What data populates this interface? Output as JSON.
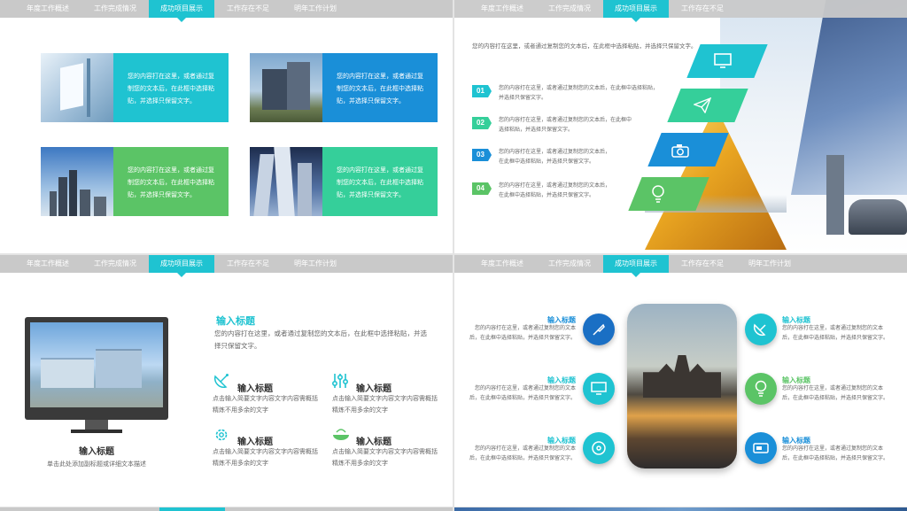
{
  "nav": [
    "年度工作概述",
    "工作完成情况",
    "成功项目展示",
    "工作存在不足",
    "明年工作计划"
  ],
  "placeholder_short": "您的内容打在这里，或者通过复制您的文本后，在此框中选择粘贴，并选择只保留文字。",
  "s2": {
    "intro": "您的内容打在这里，或者通过复制您的文本后，在此框中选择粘贴，并选择只保留文字。",
    "steps": [
      {
        "num": "01",
        "text": "您的内容打在这里，或者通过复制您的文本后，在此框中选择粘贴，并选择只保留文字。"
      },
      {
        "num": "02",
        "text": "您的内容打在这里，或者通过复制您的文本后，在此框中选择粘贴，并选择只保留文字。"
      },
      {
        "num": "03",
        "text": "您的内容打在这里，或者通过复制您的文本后，在此框中选择粘贴，并选择只保留文字。"
      },
      {
        "num": "04",
        "text": "您的内容打在这里，或者通过复制您的文本后，在此框中选择粘贴，并选择只保留文字。"
      }
    ]
  },
  "s3": {
    "title": "输入标题",
    "body": "您的内容打在这里，或者通过复制您的文本后，在此框中选择粘贴，并选择只保留文字。",
    "monitor_title": "输入标题",
    "monitor_caption": "单击此处添加副标题或详细文本描述",
    "items": [
      {
        "title": "输入标题",
        "text": "点击输入简要文字内容文字内容需概括精炼不用多余的文字"
      },
      {
        "title": "输入标题",
        "text": "点击输入简要文字内容文字内容需概括精炼不用多余的文字"
      },
      {
        "title": "输入标题",
        "text": "点击输入简要文字内容文字内容需概括精炼不用多余的文字"
      },
      {
        "title": "输入标题",
        "text": "点击输入简要文字内容文字内容需概括精炼不用多余的文字"
      }
    ]
  },
  "s4": {
    "item_title": "输入标题",
    "item_text": "您的内容打在这里，或者通过复制您的文本后，在此框中选择粘贴，并选择只保留文字。"
  },
  "colors": {
    "cyan": "#1fc3d1",
    "blue": "#1a8fd8",
    "green": "#5bc466",
    "teal": "#35cf9a",
    "navbar": "#c9c9c9"
  }
}
